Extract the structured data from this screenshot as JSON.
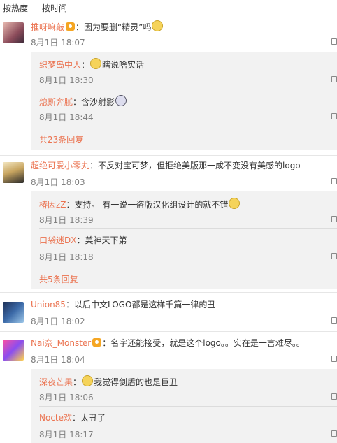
{
  "tabs": {
    "hot": "按热度",
    "time": "按时间"
  },
  "comments": [
    {
      "user": "推呀嘛敲",
      "text": "：因为要删“精灵”吗",
      "time": "8月1日 18:07",
      "replies": [
        {
          "user": "织梦岛中人",
          "text": "瞎说啥实话",
          "time": "8月1日 18:30"
        },
        {
          "user": "熄斯奔腻",
          "text": "：含沙射影",
          "time": "8月1日 18:44"
        }
      ],
      "more": "共23条回复"
    },
    {
      "user": "超绝可爱小零丸",
      "text": "：不反对宝可梦，但拒绝美版那一成不变没有美感的logo",
      "time": "8月1日 18:03",
      "replies": [
        {
          "user": "椿因zZ",
          "text": "：支持。 有一说一盗版汉化组设计的就不错",
          "time": "8月1日 18:39"
        },
        {
          "user": "口袋迷DX",
          "text": "：美神天下第一",
          "time": "8月1日 18:18"
        }
      ],
      "more": "共5条回复"
    },
    {
      "user": "Union85",
      "text": "：以后中文LOGO都是这样千篇一律的丑",
      "time": "8月1日 18:02"
    },
    {
      "user": "Nai奈_Monster",
      "text": "：名字还能接受，就是这个logo。。实在是一言难尽。。",
      "time": "8月1日 18:04",
      "replies": [
        {
          "user": "深夜芒果",
          "text": "我觉得剑盾的也是巨丑",
          "time": "8月1日 18:06"
        },
        {
          "user": "Nocte欢",
          "text": "：太丑了",
          "time": "8月1日 18:17"
        }
      ]
    }
  ],
  "colors": {
    "username": "#eb7350",
    "meta": "#808080",
    "reply_bg": "#f2f2f2"
  }
}
